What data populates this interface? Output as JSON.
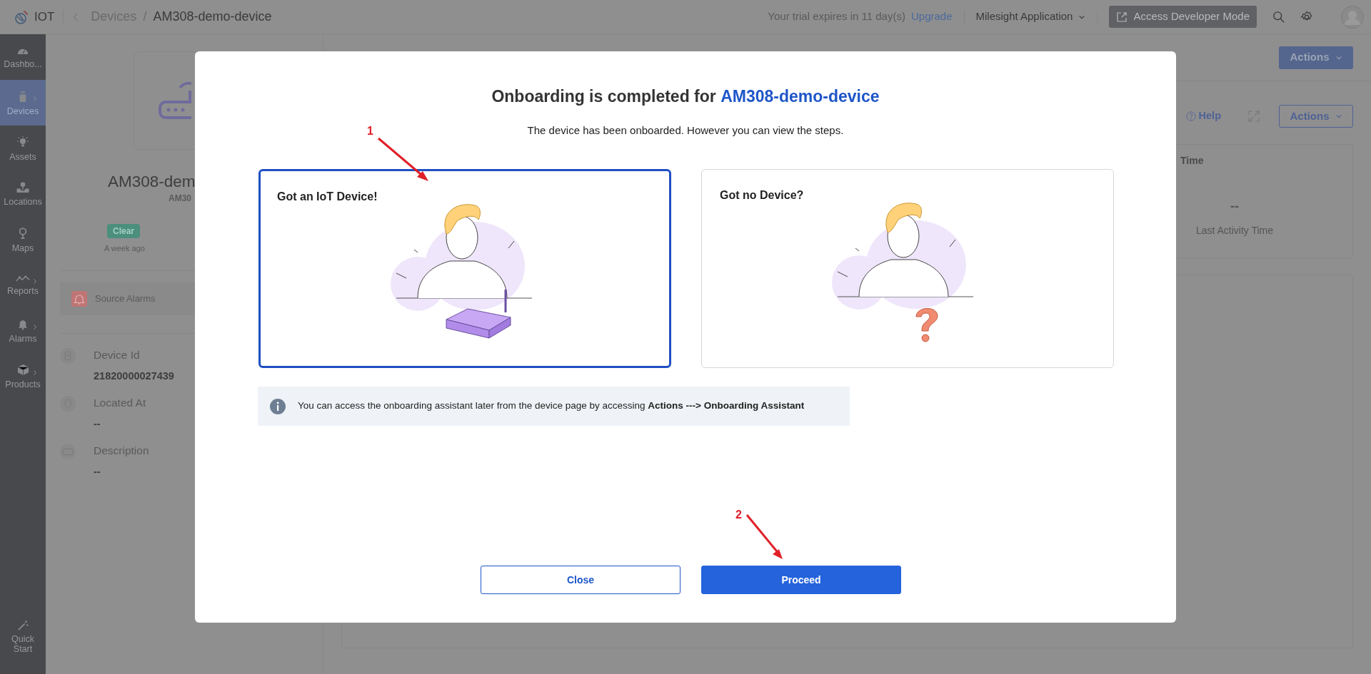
{
  "top_bar": {
    "app_name": "IOT",
    "breadcrumb": [
      {
        "label": "Devices"
      },
      {
        "label": "AM308-demo-device"
      }
    ],
    "separator": "/",
    "trial_notice": "Your trial expires in 11 day(s)",
    "upgrade_link": "Upgrade",
    "app_selector": "Milesight Application",
    "developer_button": "Access Developer Mode"
  },
  "sidebar": {
    "items": [
      {
        "label": "Dashbo...",
        "selected": false,
        "has_submenu": false
      },
      {
        "label": "Devices",
        "selected": true,
        "has_submenu": true
      },
      {
        "label": "Assets",
        "selected": false,
        "has_submenu": false
      },
      {
        "label": "Locations",
        "selected": false,
        "has_submenu": false
      },
      {
        "label": "Maps",
        "selected": false,
        "has_submenu": false
      },
      {
        "label": "Reports",
        "selected": false,
        "has_submenu": true
      },
      {
        "label": "Alarms",
        "selected": false,
        "has_submenu": true
      },
      {
        "label": "Products",
        "selected": false,
        "has_submenu": true
      }
    ],
    "quick_start": "Quick Start"
  },
  "device_panel": {
    "name": "AM308-dem",
    "model": "AM30",
    "status_badge": "Clear",
    "status_time": "A week ago",
    "source_alarms": "Source Alarms",
    "fields": [
      {
        "label": "Device Id",
        "value": "21820000027439"
      },
      {
        "label": "Located At",
        "value": "--"
      },
      {
        "label": "Description",
        "value": "--"
      }
    ]
  },
  "detail_panel": {
    "actions_button": "Actions",
    "help_link": "Help",
    "secondary_actions_button": "Actions",
    "stat_card": {
      "heading": "Time",
      "value": "--",
      "label": "Last Activity Time"
    }
  },
  "modal": {
    "title": "Onboarding is completed for **AM308-demo-device**",
    "subtitle": "The device has been onboarded. However you can view the steps.",
    "options": [
      {
        "title": "Got an IoT Device!",
        "kind": "device",
        "selected": true
      },
      {
        "title": "Got no Device?",
        "kind": "question",
        "selected": false
      }
    ],
    "info": "You can access the onboarding assistant later from the device page by accessing **Actions ---> Onboarding Assistant**",
    "buttons": [
      {
        "label": "Close",
        "kind": "secondary"
      },
      {
        "label": "Proceed",
        "kind": "primary"
      }
    ]
  },
  "annotations": [
    {
      "label": "1"
    },
    {
      "label": "2"
    }
  ]
}
